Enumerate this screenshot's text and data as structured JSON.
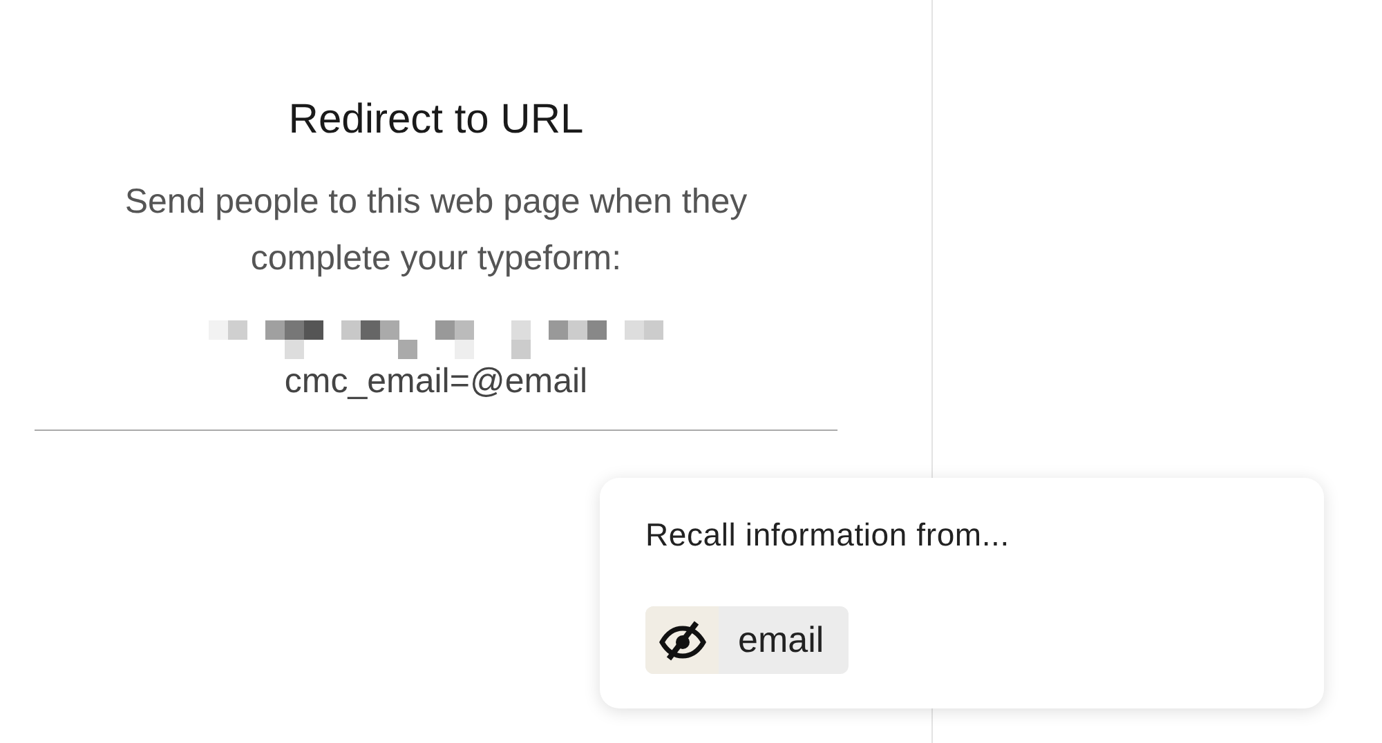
{
  "panel": {
    "title": "Redirect to URL",
    "description": "Send people to this web page when they complete your typeform:",
    "url_tail": "cmc_email=@email"
  },
  "popup": {
    "title": "Recall information from...",
    "options": [
      {
        "label": "email",
        "kind": "hidden"
      }
    ]
  }
}
